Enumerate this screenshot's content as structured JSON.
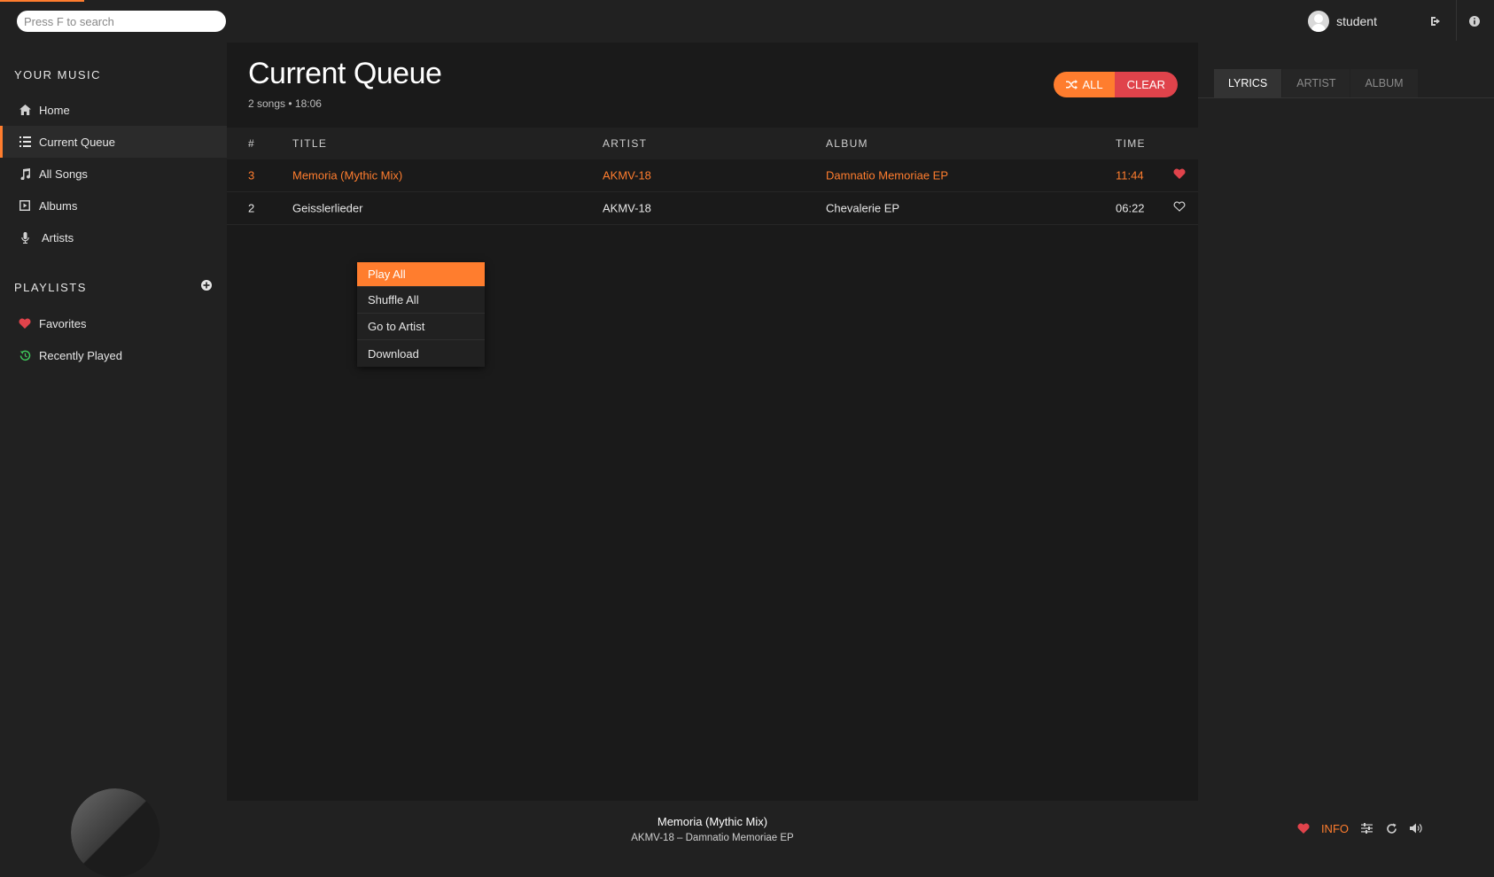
{
  "colors": {
    "accent": "#ff7d2e",
    "danger": "#e0434b",
    "heart": "#e0434b",
    "recent": "#3ec75a"
  },
  "topbar": {
    "search_placeholder": "Press F to search",
    "username": "student"
  },
  "sidebar": {
    "your_music_title": "YOUR MUSIC",
    "items": [
      {
        "label": "Home",
        "icon": "home-icon"
      },
      {
        "label": "Current Queue",
        "icon": "list-icon",
        "active": true
      },
      {
        "label": "All Songs",
        "icon": "music-note-icon"
      },
      {
        "label": "Albums",
        "icon": "album-icon"
      },
      {
        "label": "Artists",
        "icon": "microphone-icon"
      }
    ],
    "playlists_title": "PLAYLISTS",
    "playlists": [
      {
        "label": "Favorites",
        "icon": "heart-icon"
      },
      {
        "label": "Recently Played",
        "icon": "history-icon"
      }
    ]
  },
  "main": {
    "title": "Current Queue",
    "meta": "2 songs • 18:06",
    "buttons": {
      "all": "ALL",
      "clear": "CLEAR"
    },
    "columns": [
      "#",
      "TITLE",
      "ARTIST",
      "ALBUM",
      "TIME"
    ],
    "rows": [
      {
        "num": "3",
        "title": "Memoria (Mythic Mix)",
        "artist": "AKMV-18",
        "album": "Damnatio Memoriae EP",
        "time": "11:44",
        "liked": true,
        "playing": true
      },
      {
        "num": "2",
        "title": "Geisslerlieder",
        "artist": "AKMV-18",
        "album": "Chevalerie EP",
        "time": "06:22",
        "liked": false,
        "playing": false
      }
    ]
  },
  "context_menu": {
    "items": [
      "Play All",
      "Shuffle All",
      "Go to Artist",
      "Download"
    ]
  },
  "extra": {
    "tabs": [
      "LYRICS",
      "ARTIST",
      "ALBUM"
    ]
  },
  "footer": {
    "title": "Memoria (Mythic Mix)",
    "subtitle": "AKMV-18 – Damnatio Memoriae EP",
    "info_label": "INFO"
  }
}
